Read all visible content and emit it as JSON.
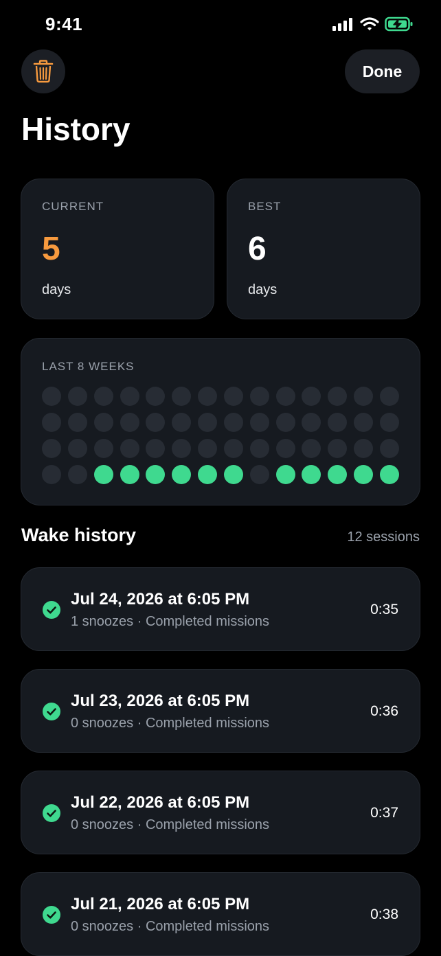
{
  "status_bar": {
    "time": "9:41"
  },
  "header": {
    "done_label": "Done",
    "title": "History"
  },
  "streaks": {
    "current": {
      "label": "CURRENT",
      "value": "5",
      "unit": "days",
      "color": "#f79a3e"
    },
    "best": {
      "label": "BEST",
      "value": "6",
      "unit": "days",
      "color": "#ffffff"
    }
  },
  "weeks": {
    "label": "LAST 8 WEEKS",
    "rows": [
      [
        0,
        0,
        0,
        0,
        0,
        0,
        0,
        0,
        0,
        0,
        0,
        0,
        0,
        0
      ],
      [
        0,
        0,
        0,
        0,
        0,
        0,
        0,
        0,
        0,
        0,
        0,
        0,
        0,
        0
      ],
      [
        0,
        0,
        0,
        0,
        0,
        0,
        0,
        0,
        0,
        0,
        0,
        0,
        0,
        0
      ],
      [
        0,
        0,
        1,
        1,
        1,
        1,
        1,
        1,
        0,
        1,
        1,
        1,
        1,
        1
      ]
    ]
  },
  "history": {
    "title": "Wake history",
    "count": "12 sessions",
    "sessions": [
      {
        "title": "Jul 24, 2026 at 6:05 PM",
        "subtitle": "1 snoozes · Completed missions",
        "duration": "0:35"
      },
      {
        "title": "Jul 23, 2026 at 6:05 PM",
        "subtitle": "0 snoozes · Completed missions",
        "duration": "0:36"
      },
      {
        "title": "Jul 22, 2026 at 6:05 PM",
        "subtitle": "0 snoozes · Completed missions",
        "duration": "0:37"
      },
      {
        "title": "Jul 21, 2026 at 6:05 PM",
        "subtitle": "0 snoozes · Completed missions",
        "duration": "0:38"
      }
    ]
  },
  "colors": {
    "accent_green": "#3fd98f",
    "accent_orange": "#f79a3e",
    "card_bg": "#161a20"
  }
}
